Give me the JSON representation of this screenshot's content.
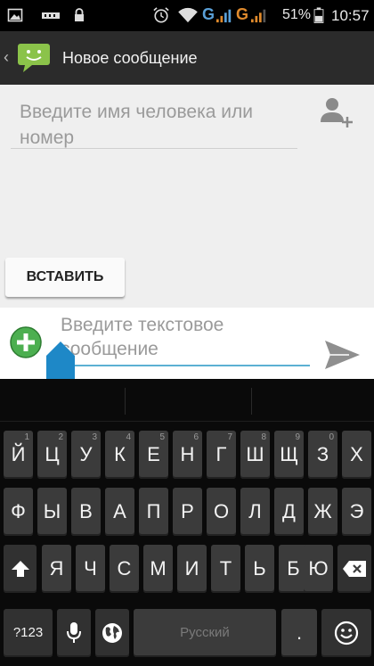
{
  "status_bar": {
    "battery_percent": "51%",
    "time": "10:57",
    "network_1": "G",
    "network_2": "G"
  },
  "action_bar": {
    "title": "Новое сообщение"
  },
  "recipient": {
    "placeholder": "Введите имя человека или номер"
  },
  "paste_button": {
    "label": "ВСТАВИТЬ"
  },
  "compose": {
    "placeholder": "Введите текстовое сообщение"
  },
  "keyboard": {
    "row1": [
      {
        "label": "Й",
        "hint": "1"
      },
      {
        "label": "Ц",
        "hint": "2"
      },
      {
        "label": "У",
        "hint": "3"
      },
      {
        "label": "К",
        "hint": "4"
      },
      {
        "label": "Е",
        "hint": "5"
      },
      {
        "label": "Н",
        "hint": "6"
      },
      {
        "label": "Г",
        "hint": "7"
      },
      {
        "label": "Ш",
        "hint": "8"
      },
      {
        "label": "Щ",
        "hint": "9"
      },
      {
        "label": "З",
        "hint": "0"
      },
      {
        "label": "Х",
        "hint": ""
      }
    ],
    "row2": [
      "Ф",
      "Ы",
      "В",
      "А",
      "П",
      "Р",
      "О",
      "Л",
      "Д",
      "Ж",
      "Э"
    ],
    "row3": [
      "Я",
      "Ч",
      "С",
      "М",
      "И",
      "Т",
      "Ь",
      "Б",
      "Ю"
    ],
    "symbols_label": "?123",
    "space_label": "Русский",
    "period_label": "."
  },
  "colors": {
    "accent_line": "#5bb0d3",
    "app_icon_green": "#8bc34a",
    "attach_green": "#4caf50",
    "cursor_handle": "#1e88c7"
  }
}
